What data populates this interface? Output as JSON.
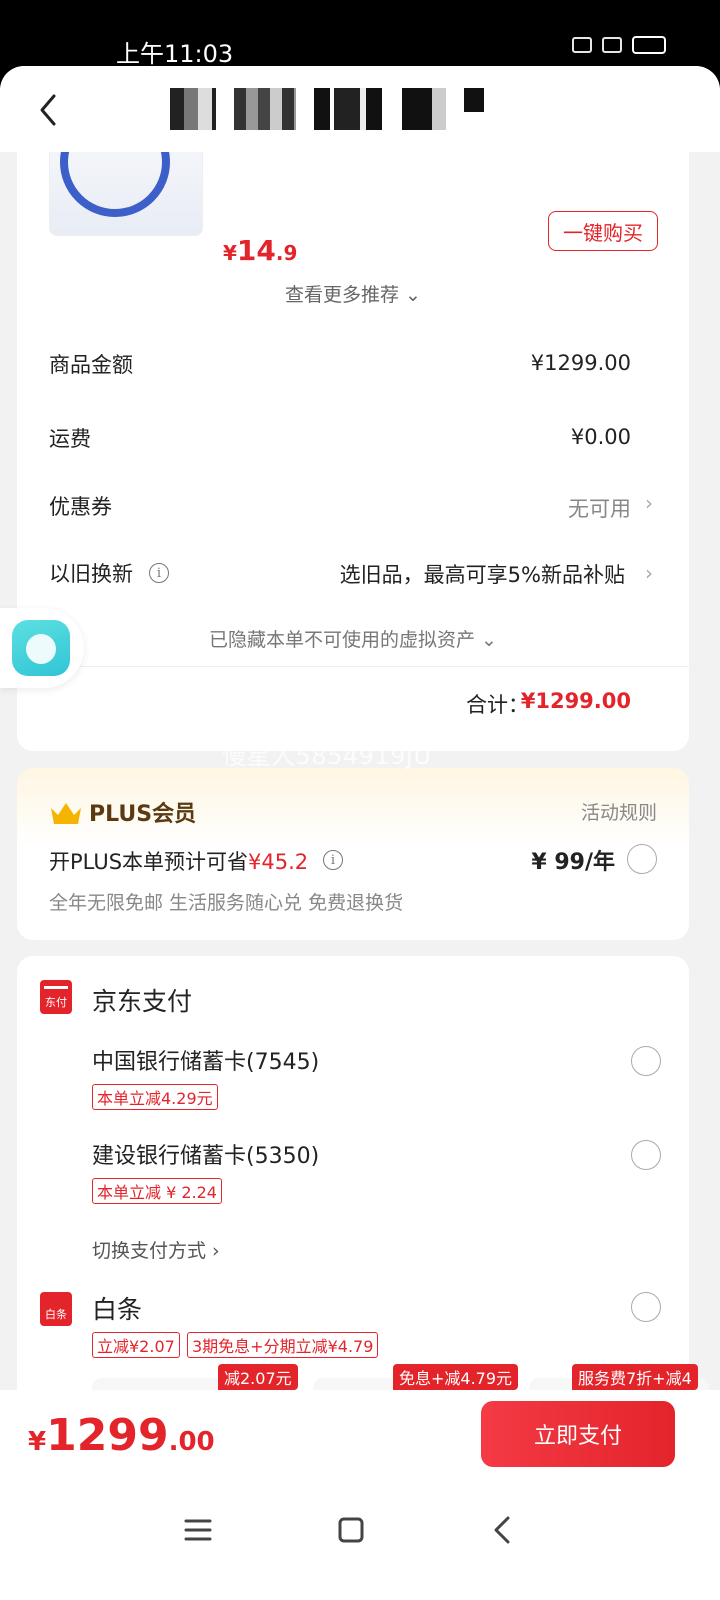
{
  "status_bar": {
    "time": "上午11:03"
  },
  "recommend": {
    "price_symbol": "¥",
    "price_int": "14",
    "price_dec": ".9",
    "buy_label": "一键购买",
    "more_label": "查看更多推荐 ⌄"
  },
  "summary": {
    "goods_label": "商品金额",
    "goods_value": "¥1299.00",
    "shipping_label": "运费",
    "shipping_value": "¥0.00",
    "coupon_label": "优惠券",
    "coupon_value": "无可用",
    "tradein_label": "以旧换新",
    "tradein_value": "选旧品，最高可享5%新品补贴",
    "hidden_assets": "已隐藏本单不可使用的虚拟资产 ⌄",
    "total_label": "合计：",
    "total_value": "¥1299.00"
  },
  "watermark": "慢星人5854919JU",
  "plus": {
    "title": "PLUS会员",
    "rules": "活动规则",
    "save_prefix": "开PLUS本单预计可省",
    "save_amount": "¥45.2",
    "price": "¥ 99/年",
    "perks": "全年无限免邮 生活服务随心兑 免费退换货"
  },
  "payment": {
    "jd_pay": {
      "logo_text": "东付",
      "title": "京东支付",
      "cards": [
        {
          "name": "中国银行储蓄卡(7545)",
          "tag": "本单立减4.29元"
        },
        {
          "name": "建设银行储蓄卡(5350)",
          "tag": "本单立减 ¥ 2.24"
        }
      ],
      "switch_label": "切换支付方式 ›"
    },
    "baitiao": {
      "logo_text": "白条",
      "title": "白条",
      "tags": [
        "立减¥2.07",
        "3期免息+分期立减¥4.79"
      ],
      "plans": [
        "减2.07元",
        "免息+减4.79元",
        "服务费7折+减4"
      ]
    }
  },
  "bottom": {
    "price_symbol": "¥",
    "price_int": "1299",
    "price_dec": ".00",
    "pay_label": "立即支付"
  },
  "colors": {
    "accent": "#e3242b",
    "background": "#f2f2f2",
    "plus_gold": "#f5b400"
  }
}
